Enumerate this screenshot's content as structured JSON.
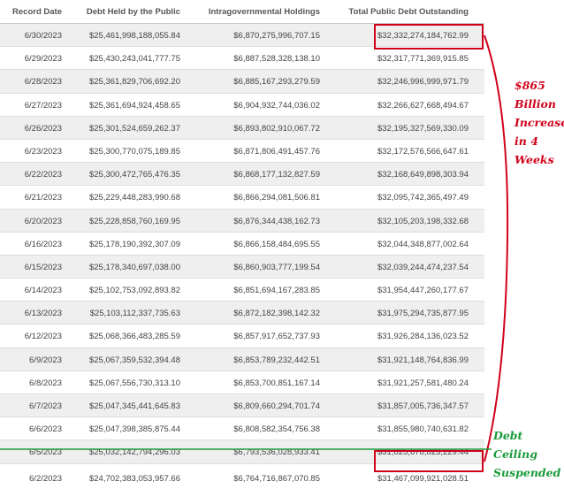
{
  "headers": [
    "Record Date",
    "Debt Held by the Public",
    "Intragovernmental Holdings",
    "Total Public Debt Outstanding"
  ],
  "rows": [
    {
      "date": "6/30/2023",
      "public": "$25,461,998,188,055.84",
      "intra": "$6,870,275,996,707.15",
      "total": "$32,332,274,184,762.99"
    },
    {
      "date": "6/29/2023",
      "public": "$25,430,243,041,777.75",
      "intra": "$6,887,528,328,138.10",
      "total": "$32,317,771,369,915.85"
    },
    {
      "date": "6/28/2023",
      "public": "$25,361,829,706,692.20",
      "intra": "$6,885,167,293,279.59",
      "total": "$32,246,996,999,971.79"
    },
    {
      "date": "6/27/2023",
      "public": "$25,361,694,924,458.65",
      "intra": "$6,904,932,744,036.02",
      "total": "$32,266,627,668,494.67"
    },
    {
      "date": "6/26/2023",
      "public": "$25,301,524,659,262.37",
      "intra": "$6,893,802,910,067.72",
      "total": "$32,195,327,569,330.09"
    },
    {
      "date": "6/23/2023",
      "public": "$25,300,770,075,189.85",
      "intra": "$6,871,806,491,457.76",
      "total": "$32,172,576,566,647.61"
    },
    {
      "date": "6/22/2023",
      "public": "$25,300,472,765,476.35",
      "intra": "$6,868,177,132,827.59",
      "total": "$32,168,649,898,303.94"
    },
    {
      "date": "6/21/2023",
      "public": "$25,229,448,283,990.68",
      "intra": "$6,866,294,081,506.81",
      "total": "$32,095,742,365,497.49"
    },
    {
      "date": "6/20/2023",
      "public": "$25,228,858,760,169.95",
      "intra": "$6,876,344,438,162.73",
      "total": "$32,105,203,198,332.68"
    },
    {
      "date": "6/16/2023",
      "public": "$25,178,190,392,307.09",
      "intra": "$6,866,158,484,695.55",
      "total": "$32,044,348,877,002.64"
    },
    {
      "date": "6/15/2023",
      "public": "$25,178,340,697,038.00",
      "intra": "$6,860,903,777,199.54",
      "total": "$32,039,244,474,237.54"
    },
    {
      "date": "6/14/2023",
      "public": "$25,102,753,092,893.82",
      "intra": "$6,851,694,167,283.85",
      "total": "$31,954,447,260,177.67"
    },
    {
      "date": "6/13/2023",
      "public": "$25,103,112,337,735.63",
      "intra": "$6,872,182,398,142.32",
      "total": "$31,975,294,735,877.95"
    },
    {
      "date": "6/12/2023",
      "public": "$25,068,366,483,285.59",
      "intra": "$6,857,917,652,737.93",
      "total": "$31,926,284,136,023.52"
    },
    {
      "date": "6/9/2023",
      "public": "$25,067,359,532,394.48",
      "intra": "$6,853,789,232,442.51",
      "total": "$31,921,148,764,836.99"
    },
    {
      "date": "6/8/2023",
      "public": "$25,067,556,730,313.10",
      "intra": "$6,853,700,851,167.14",
      "total": "$31,921,257,581,480.24"
    },
    {
      "date": "6/7/2023",
      "public": "$25,047,345,441,645.83",
      "intra": "$6,809,660,294,701.74",
      "total": "$31,857,005,736,347.57"
    },
    {
      "date": "6/6/2023",
      "public": "$25,047,398,385,875.44",
      "intra": "$6,808,582,354,756.38",
      "total": "$31,855,980,740,631.82"
    },
    {
      "date": "6/5/2023",
      "public": "$25,032,142,794,296.03",
      "intra": "$6,793,536,028,933.41",
      "total": "$31,825,678,823,229.44"
    },
    {
      "date": "6/2/2023",
      "public": "$24,702,383,053,957.66",
      "intra": "$6,764,716,867,070.85",
      "total": "$31,467,099,921,028.51"
    }
  ],
  "annotations": {
    "increase_lines": [
      "$865",
      "Billion",
      "Increase",
      "in 4",
      "Weeks"
    ],
    "ceiling_lines": [
      "Debt Ceiling",
      "Suspended"
    ]
  },
  "colors": {
    "highlight": "#d0021b",
    "ceiling": "#1a9b3a",
    "stripe": "#efefef"
  }
}
